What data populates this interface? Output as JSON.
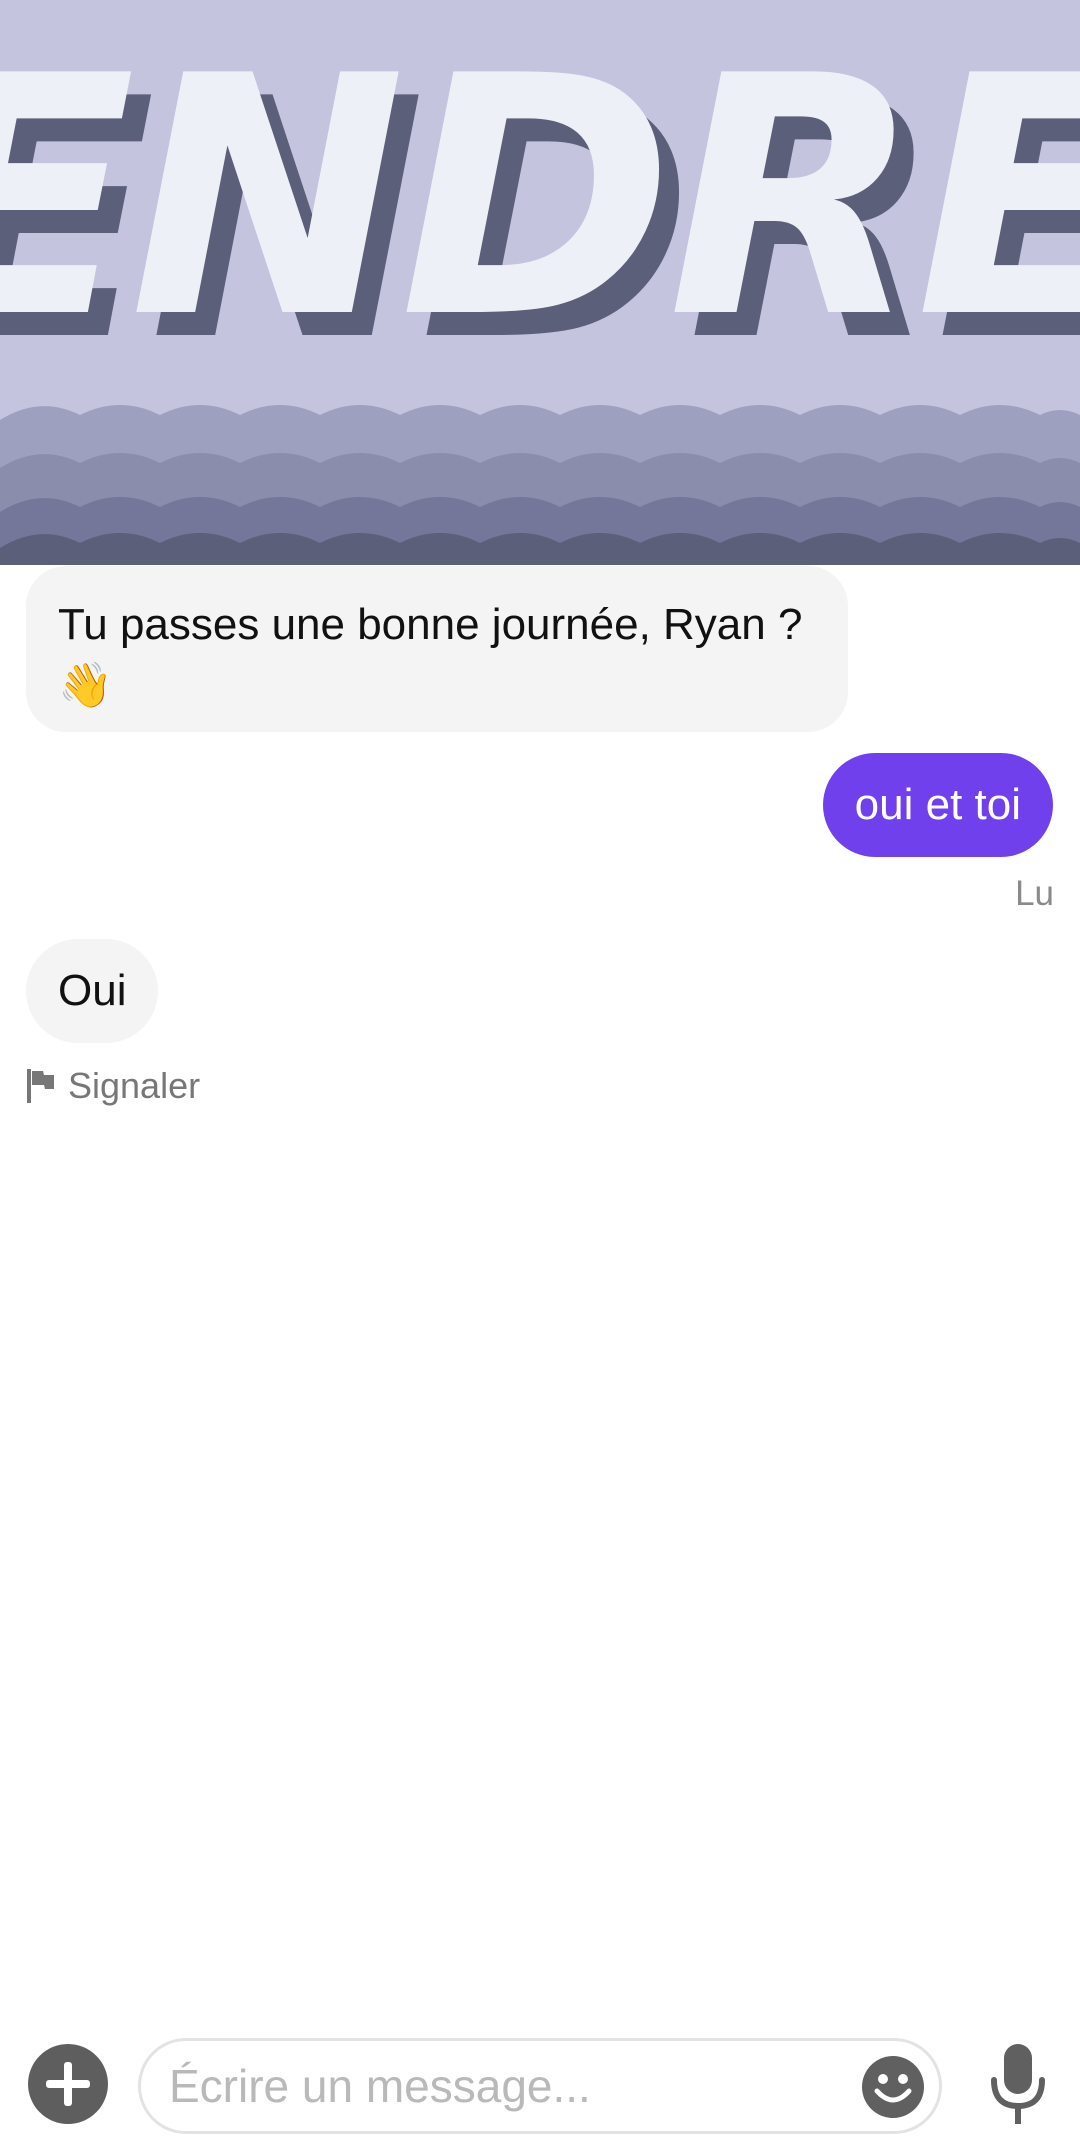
{
  "banner": {
    "gif_text": "ENDRED",
    "icon": "gif-sticker"
  },
  "messages": [
    {
      "direction": "incoming",
      "text": "Tu passes une bonne journée, Ryan ?",
      "emoji": "👋"
    },
    {
      "direction": "outgoing",
      "text": "oui et toi",
      "status": "Lu"
    },
    {
      "direction": "incoming",
      "text": "Oui"
    }
  ],
  "report": {
    "label": "Signaler",
    "icon": "flag-icon"
  },
  "composer": {
    "placeholder": "Écrire un message...",
    "value": "",
    "add_icon": "plus-icon",
    "emoji_icon": "smiley-icon",
    "mic_icon": "microphone-icon"
  },
  "colors": {
    "accent": "#7040ec",
    "incoming_bubble": "#f4f4f4",
    "banner_bg": "#c4c4de",
    "banner_text": "#eef0f8",
    "banner_shadow": "#5c5f7a"
  }
}
